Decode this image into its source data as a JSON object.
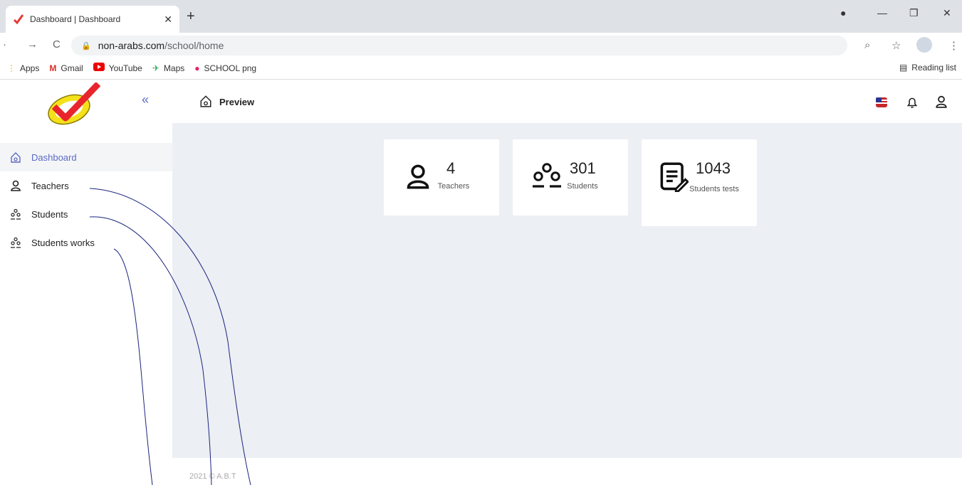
{
  "browser": {
    "tab_title": "Dashboard | Dashboard",
    "url_host": "non-arabs.com",
    "url_path": "/school/home",
    "bookmarks": [
      {
        "label": "Apps",
        "icon": "apps-grid-icon"
      },
      {
        "label": "Gmail",
        "icon": "gmail-icon"
      },
      {
        "label": "YouTube",
        "icon": "youtube-icon"
      },
      {
        "label": "Maps",
        "icon": "maps-icon"
      },
      {
        "label": "SCHOOL png",
        "icon": "school-icon"
      }
    ],
    "reading_list": "Reading list"
  },
  "header": {
    "preview": "Preview"
  },
  "sidebar": {
    "items": [
      {
        "label": "Dashboard",
        "icon": "home-icon"
      },
      {
        "label": "Teachers",
        "icon": "user-icon"
      },
      {
        "label": "Students",
        "icon": "users-group-icon"
      },
      {
        "label": "Students works",
        "icon": "users-group-icon"
      }
    ]
  },
  "stats": [
    {
      "value": "4",
      "label": "Teachers",
      "icon": "user-icon"
    },
    {
      "value": "301",
      "label": "Students",
      "icon": "users-group-icon"
    },
    {
      "value": "1043",
      "label": "Students tests",
      "icon": "test-edit-icon"
    }
  ],
  "footer": {
    "text": "2021 © A.B.T"
  },
  "colors": {
    "accent": "#5b6ac4",
    "content_bg": "#eceff4"
  }
}
